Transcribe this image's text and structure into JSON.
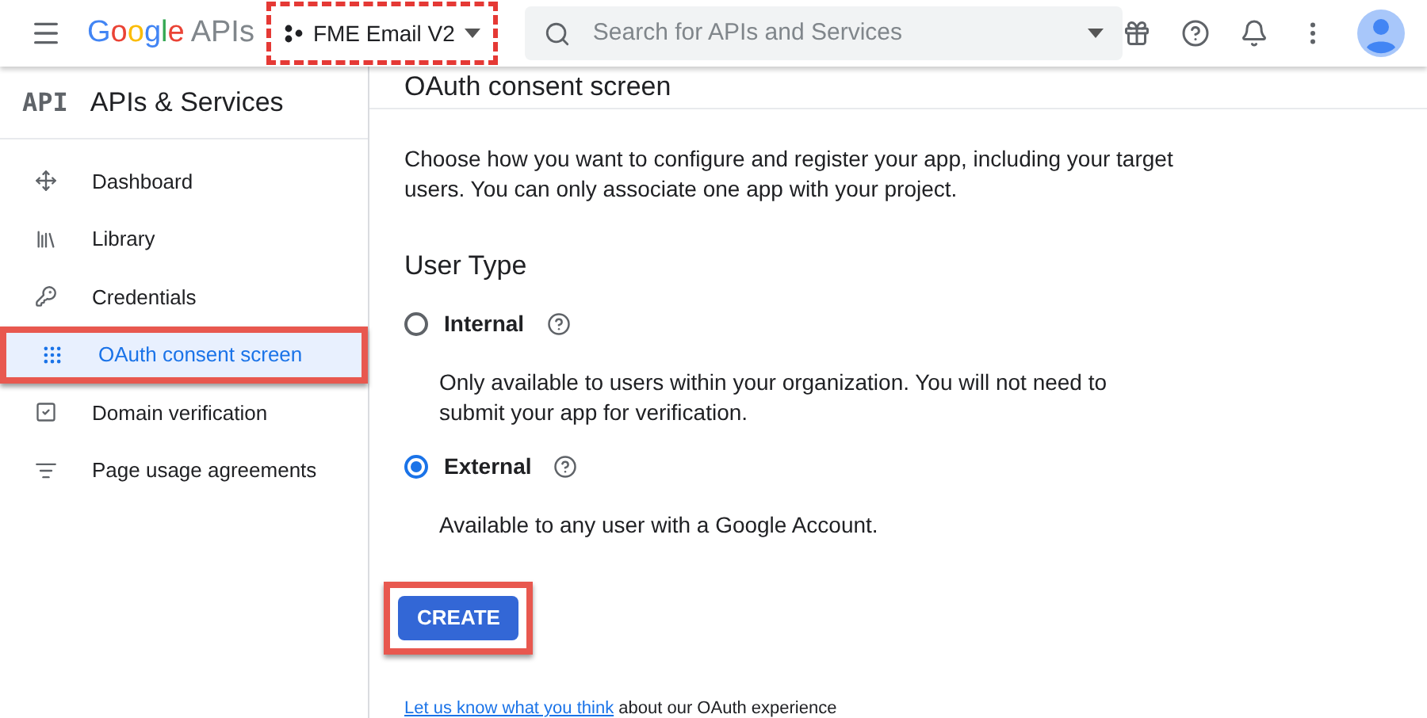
{
  "header": {
    "logo": {
      "brand": "Google",
      "product": "APIs"
    },
    "project": {
      "name": "FME Email V2",
      "highlighted": true
    },
    "search": {
      "placeholder": "Search for APIs and Services"
    }
  },
  "subheader": {
    "badge": "API",
    "section": "APIs & Services",
    "page_title": "OAuth consent screen"
  },
  "sidebar": {
    "items": [
      {
        "label": "Dashboard",
        "selected": false,
        "highlighted": false
      },
      {
        "label": "Library",
        "selected": false,
        "highlighted": false
      },
      {
        "label": "Credentials",
        "selected": false,
        "highlighted": false
      },
      {
        "label": "OAuth consent screen",
        "selected": true,
        "highlighted": true
      },
      {
        "label": "Domain verification",
        "selected": false,
        "highlighted": false
      },
      {
        "label": "Page usage agreements",
        "selected": false,
        "highlighted": false
      }
    ]
  },
  "main": {
    "intro": "Choose how you want to configure and register your app, including your target users. You can only associate one app with your project.",
    "user_type": {
      "heading": "User Type",
      "options": [
        {
          "label": "Internal",
          "selected": false,
          "description": "Only available to users within your organization. You will not need to submit your app for verification."
        },
        {
          "label": "External",
          "selected": true,
          "description": "Available to any user with a Google Account."
        }
      ]
    },
    "create_button": {
      "label": "CREATE",
      "highlighted": true
    },
    "feedback": {
      "link": "Let us know what you think",
      "text": "about our OAuth experience"
    }
  }
}
